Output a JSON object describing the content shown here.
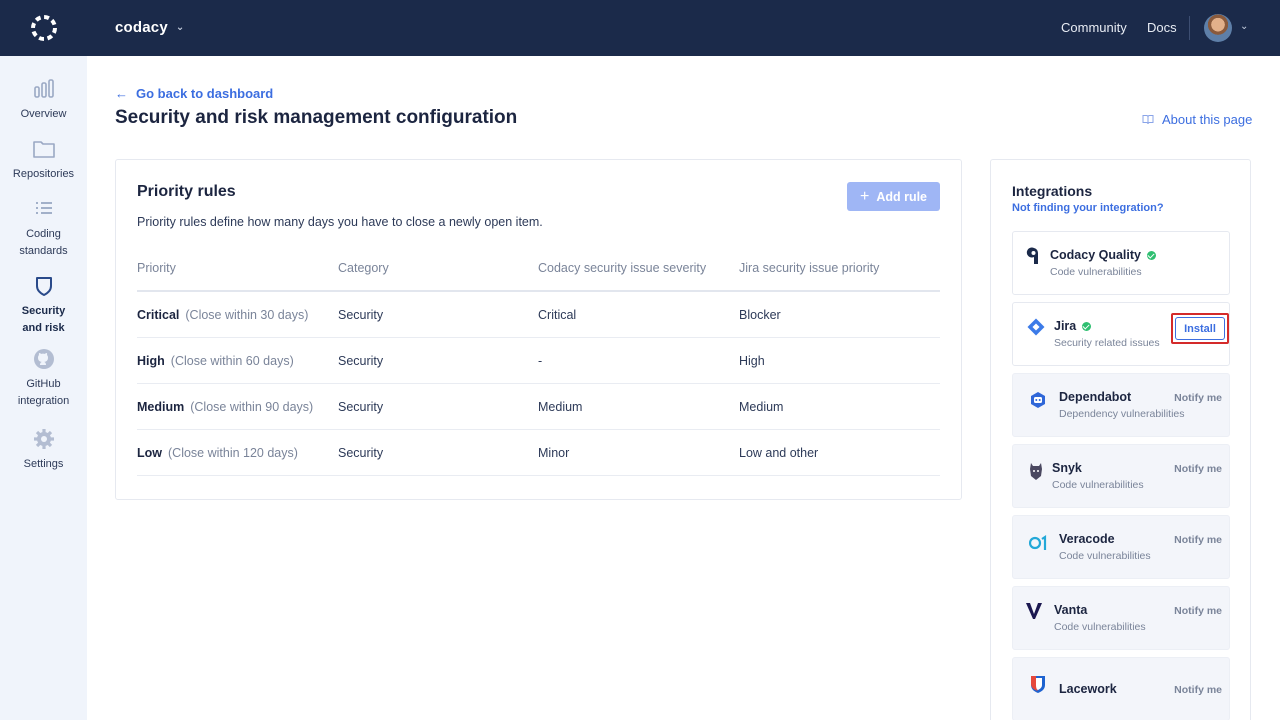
{
  "app": {
    "brand": "codacy"
  },
  "header": {
    "community": "Community",
    "docs": "Docs"
  },
  "sidebar": {
    "items": [
      {
        "label": "Overview",
        "icon": "bar-chart-icon"
      },
      {
        "label": "Repositories",
        "icon": "folder-icon"
      },
      {
        "label": "Coding standards",
        "icon": "list-icon"
      },
      {
        "label": "Security and risk",
        "icon": "shield-icon",
        "active": true
      },
      {
        "label": "GitHub integration",
        "icon": "github-icon"
      },
      {
        "label": "Settings",
        "icon": "gear-icon"
      }
    ]
  },
  "main": {
    "back_link": "Go back to dashboard",
    "title": "Security and risk management configuration",
    "about_link": "About this page"
  },
  "rules": {
    "title": "Priority rules",
    "description": "Priority rules define how many days you have to close a newly open item.",
    "add_button": "Add rule",
    "columns": [
      "Priority",
      "Category",
      "Codacy security issue severity",
      "Jira security issue priority"
    ],
    "rows": [
      {
        "priority": "Critical",
        "note": "(Close within 30 days)",
        "category": "Security",
        "severity": "Critical",
        "jira": "Blocker"
      },
      {
        "priority": "High",
        "note": "(Close within 60 days)",
        "category": "Security",
        "severity": "-",
        "jira": "High"
      },
      {
        "priority": "Medium",
        "note": "(Close within 90 days)",
        "category": "Security",
        "severity": "Medium",
        "jira": "Medium"
      },
      {
        "priority": "Low",
        "note": "(Close within 120 days)",
        "category": "Security",
        "severity": "Minor",
        "jira": "Low and other"
      }
    ]
  },
  "integrations": {
    "title": "Integrations",
    "subtitle": "Not finding your integration?",
    "items": [
      {
        "name": "Codacy Quality",
        "desc": "Code vulnerabilities",
        "icon": "codacy-quality-icon",
        "connected": true
      },
      {
        "name": "Jira",
        "desc": "Security related issues",
        "icon": "jira-icon",
        "connected": true,
        "action": "Install"
      },
      {
        "name": "Dependabot",
        "desc": "Dependency vulnerabilities",
        "icon": "dependabot-icon",
        "action": "Notify me"
      },
      {
        "name": "Snyk",
        "desc": "Code vulnerabilities",
        "icon": "snyk-icon",
        "action": "Notify me"
      },
      {
        "name": "Veracode",
        "desc": "Code vulnerabilities",
        "icon": "veracode-icon",
        "action": "Notify me"
      },
      {
        "name": "Vanta",
        "desc": "Code vulnerabilities",
        "icon": "vanta-icon",
        "action": "Notify me"
      },
      {
        "name": "Lacework",
        "desc": "",
        "icon": "lacework-icon",
        "action": "Notify me"
      }
    ]
  },
  "colors": {
    "topbar": "#1b2a4a",
    "accent": "#3c6ee0",
    "success": "#2fbf71",
    "highlight": "#d42a2a"
  }
}
